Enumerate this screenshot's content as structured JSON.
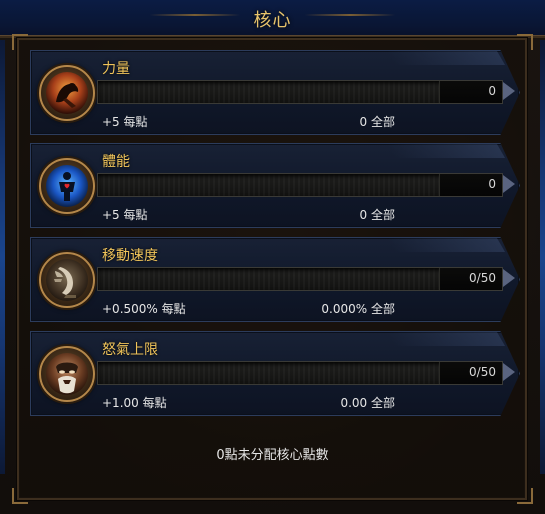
{
  "window": {
    "title": "核心"
  },
  "stats": [
    {
      "name": "力量",
      "icon": "strength-icon",
      "bar_value": "0",
      "fill_fraction": 0,
      "per_point": "+5 每點",
      "total": "0 全部"
    },
    {
      "name": "體能",
      "icon": "vitality-icon",
      "bar_value": "0",
      "fill_fraction": 0,
      "per_point": "+5 每點",
      "total": "0 全部"
    },
    {
      "name": "移動速度",
      "icon": "movement-speed-icon",
      "bar_value": "0/50",
      "fill_fraction": 0,
      "per_point": "+0.500% 每點",
      "total": "0.000% 全部"
    },
    {
      "name": "怒氣上限",
      "icon": "max-fury-icon",
      "bar_value": "0/50",
      "fill_fraction": 0,
      "per_point": "+1.00 每點",
      "total": "0.00 全部"
    }
  ],
  "footer": {
    "unallocated": "0點未分配核心點數"
  },
  "colors": {
    "title_gold": "#e8c46c",
    "stat_name_gold": "#f0c45a",
    "panel_blue": "#182135",
    "frame_brown": "#3d2e1e",
    "text_white": "#e6e6e6"
  }
}
